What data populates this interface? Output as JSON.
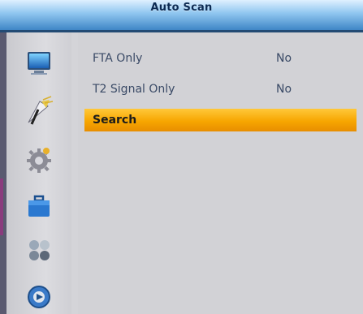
{
  "header": {
    "title": "Auto Scan"
  },
  "sidebar": {
    "icons": [
      "tv-screen-icon",
      "satellite-dish-icon",
      "gear-settings-icon",
      "toolbox-icon",
      "media-dots-icon",
      "disc-media-icon"
    ]
  },
  "menu": {
    "items": [
      {
        "label": "FTA Only",
        "value": "No"
      },
      {
        "label": "T2 Signal Only",
        "value": "No"
      },
      {
        "label": "Search",
        "value": ""
      }
    ],
    "selected_index": 2
  },
  "colors": {
    "title_bar": "#8ec5ef",
    "highlight": "#f7a600",
    "panel": "#d2d2d6",
    "text": "#3a4a66"
  }
}
